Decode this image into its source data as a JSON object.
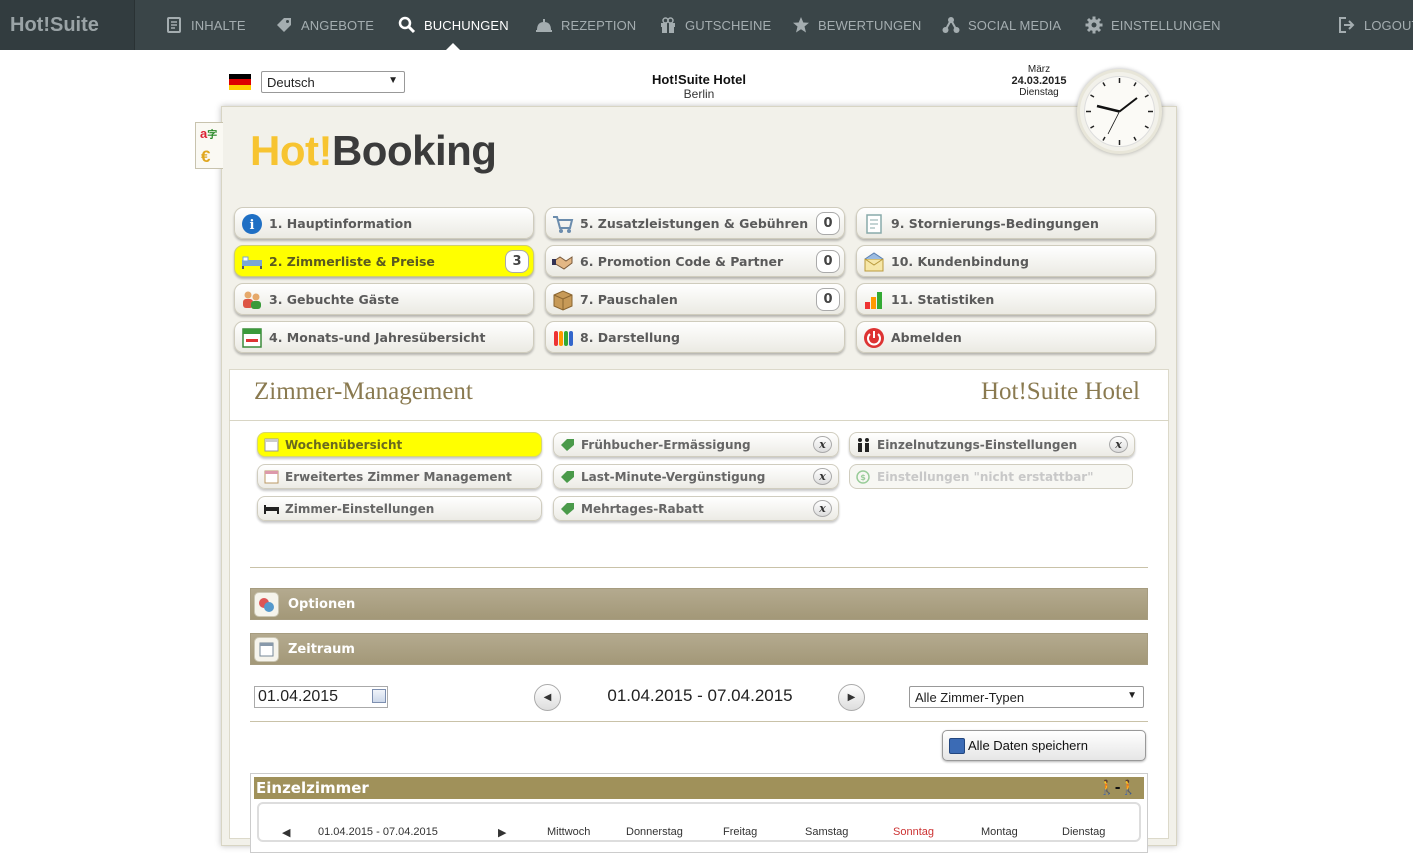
{
  "nav": {
    "brand": "Hot!Suite",
    "items": [
      {
        "label": "INHALTE",
        "icon": "document-icon"
      },
      {
        "label": "ANGEBOTE",
        "icon": "tag-icon"
      },
      {
        "label": "BUCHUNGEN",
        "icon": "search-key-icon",
        "active": true
      },
      {
        "label": "REZEPTION",
        "icon": "bell-icon"
      },
      {
        "label": "GUTSCHEINE",
        "icon": "gift-icon"
      },
      {
        "label": "BEWERTUNGEN",
        "icon": "star-icon"
      },
      {
        "label": "SOCIAL MEDIA",
        "icon": "network-icon"
      },
      {
        "label": "EINSTELLUNGEN",
        "icon": "gear-icon"
      }
    ],
    "logout": "LOGOUT"
  },
  "header": {
    "language": "Deutsch",
    "hotel_name": "Hot!Suite Hotel",
    "hotel_city": "Berlin",
    "month": "März",
    "date": "24.03.2015",
    "weekday": "Dienstag"
  },
  "logo": {
    "hot": "Hot!",
    "booking": "Booking"
  },
  "menu": [
    {
      "label": "1. Hauptinformation",
      "icon": "info-icon"
    },
    {
      "label": "2. Zimmerliste & Preise",
      "icon": "bed-icon",
      "count": "3",
      "active": true
    },
    {
      "label": "3. Gebuchte Gäste",
      "icon": "guests-icon"
    },
    {
      "label": "4. Monats-und Jahresübersicht",
      "icon": "calendar-icon"
    },
    {
      "label": "5. Zusatzleistungen & Gebühren",
      "icon": "cart-icon",
      "count": "0"
    },
    {
      "label": "6. Promotion Code & Partner",
      "icon": "handshake-icon",
      "count": "0"
    },
    {
      "label": "7. Pauschalen",
      "icon": "package-icon",
      "count": "0"
    },
    {
      "label": "8. Darstellung",
      "icon": "palette-icon"
    },
    {
      "label": "9. Stornierungs-Bedingungen",
      "icon": "document-list-icon"
    },
    {
      "label": "10. Kundenbindung",
      "icon": "mail-icon"
    },
    {
      "label": "11. Statistiken",
      "icon": "chart-icon"
    },
    {
      "label": "Abmelden",
      "icon": "power-icon"
    }
  ],
  "zm": {
    "title": "Zimmer-Management",
    "hotel": "Hot!Suite Hotel",
    "buttons": [
      {
        "label": "Wochenübersicht",
        "active": true
      },
      {
        "label": "Erweitertes Zimmer Management"
      },
      {
        "label": "Zimmer-Einstellungen"
      },
      {
        "label": "Frühbucher-Ermässigung",
        "x": "x"
      },
      {
        "label": "Last-Minute-Vergünstigung",
        "x": "x"
      },
      {
        "label": "Mehrtages-Rabatt",
        "x": "x"
      },
      {
        "label": "Einzelnutzungs-Einstellungen",
        "x": "x"
      },
      {
        "label": "Einstellungen \"nicht erstattbar\"",
        "disabled": true
      }
    ],
    "optionen": "Optionen",
    "zeitraum": "Zeitraum",
    "date_from": "01.04.2015",
    "range": "01.04.2015 - 07.04.2015",
    "room_type": "Alle Zimmer-Typen",
    "save": "Alle Daten speichern",
    "room": "Einzelzimmer",
    "room_row": {
      "range": "01.04.2015 - 07.04.2015",
      "days": [
        "Mittwoch",
        "Donnerstag",
        "Freitag",
        "Samstag",
        "Sonntag",
        "Montag",
        "Dienstag"
      ]
    }
  },
  "colors": {
    "topnav": "#3a4548",
    "active_yellow": "#ffff00",
    "bar": "#a69c80",
    "room_bar": "#a0915a"
  }
}
